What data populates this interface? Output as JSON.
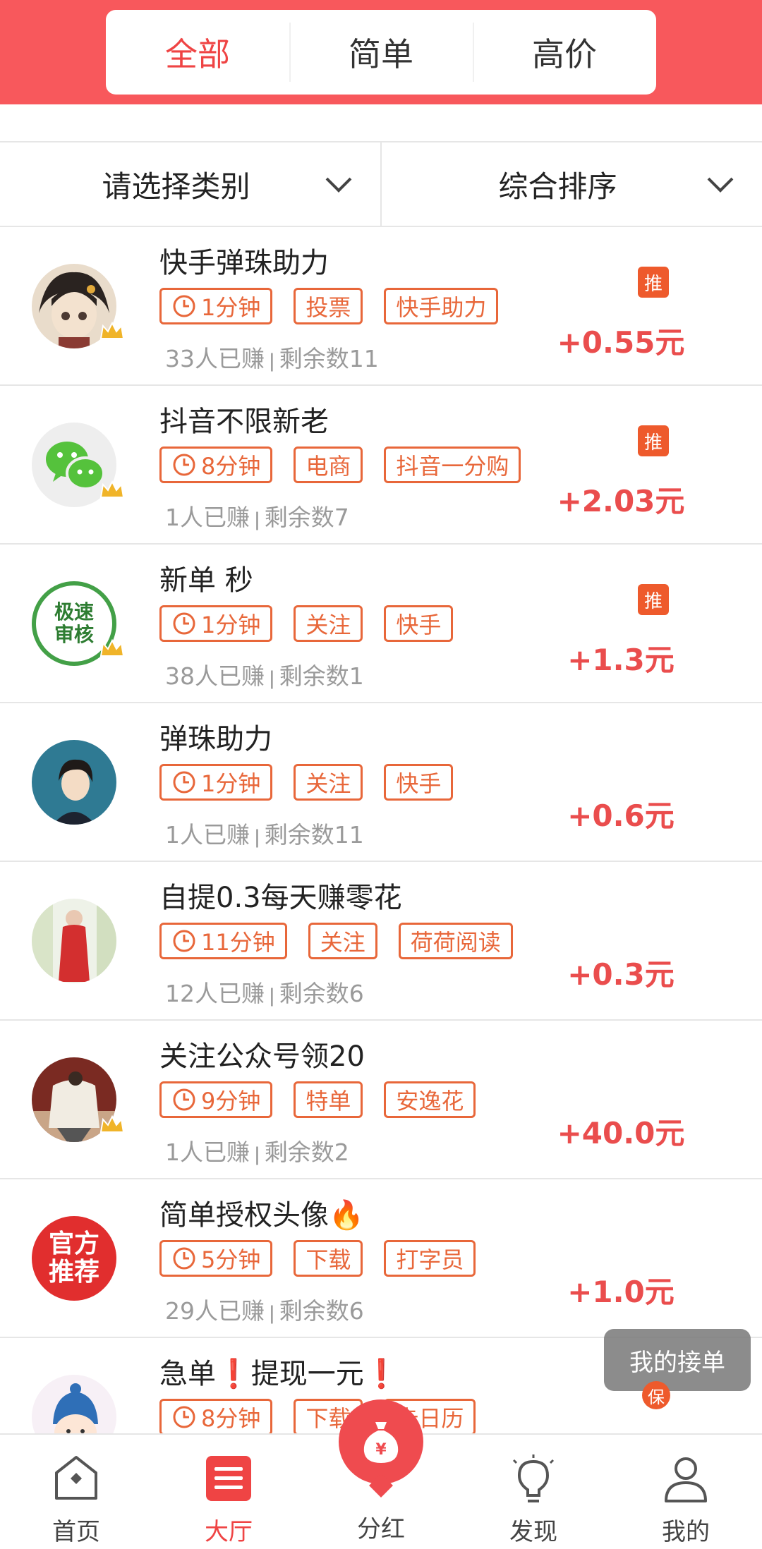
{
  "tabs": [
    {
      "label": "全部",
      "active": true
    },
    {
      "label": "简单",
      "active": false
    },
    {
      "label": "高价",
      "active": false
    }
  ],
  "filters": {
    "category": "请选择类别",
    "sort": "综合排序"
  },
  "tasks": [
    {
      "title": "快手弹珠助力",
      "duration": "1分钟",
      "tags": [
        "投票",
        "快手助力"
      ],
      "earned": "33人已赚",
      "remaining": "剩余数11",
      "reward": "+0.55元",
      "badge": "推",
      "avatar": "anime-boy-avatar"
    },
    {
      "title": "抖音不限新老",
      "duration": "8分钟",
      "tags": [
        "电商",
        "抖音一分购"
      ],
      "earned": "1人已赚",
      "remaining": "剩余数7",
      "reward": "+2.03元",
      "badge": "推",
      "avatar": "wechat-avatar"
    },
    {
      "title": "新单 秒",
      "duration": "1分钟",
      "tags": [
        "关注",
        "快手"
      ],
      "earned": "38人已赚",
      "remaining": "剩余数1",
      "reward": "+1.3元",
      "badge": "推",
      "avatar": "fast-review-avatar",
      "avatar_text": "极速审核"
    },
    {
      "title": "弹珠助力",
      "duration": "1分钟",
      "tags": [
        "关注",
        "快手"
      ],
      "earned": "1人已赚",
      "remaining": "剩余数11",
      "reward": "+0.6元",
      "badge": "",
      "avatar": "anime-avatar"
    },
    {
      "title": "自提0.3每天赚零花",
      "duration": "11分钟",
      "tags": [
        "关注",
        "荷荷阅读"
      ],
      "earned": "12人已赚",
      "remaining": "剩余数6",
      "reward": "+0.3元",
      "badge": "",
      "avatar": "photo-avatar"
    },
    {
      "title": "关注公众号领20",
      "duration": "9分钟",
      "tags": [
        "特单",
        "安逸花"
      ],
      "earned": "1人已赚",
      "remaining": "剩余数2",
      "reward": "+40.0元",
      "badge": "",
      "avatar": "photo-avatar-2"
    },
    {
      "title": "简单授权头像🔥",
      "duration": "5分钟",
      "tags": [
        "下载",
        "打字员"
      ],
      "earned": "29人已赚",
      "remaining": "剩余数6",
      "reward": "+1.0元",
      "badge": "",
      "avatar": "official-avatar",
      "avatar_text": "官方推荐"
    },
    {
      "title": "急单❗️提现一元❗️",
      "duration": "8分钟",
      "tags": [
        "下载",
        "卡日历"
      ],
      "earned": "",
      "remaining": "",
      "reward": "",
      "badge": "",
      "avatar": "cartoon-avatar"
    }
  ],
  "floating": {
    "label": "我的接单",
    "sub": "保"
  },
  "nav": [
    {
      "label": "首页",
      "icon": "home-icon",
      "active": false
    },
    {
      "label": "大厅",
      "icon": "hall-list-icon",
      "active": true
    },
    {
      "label": "分红",
      "icon": "money-bag-icon",
      "active": false
    },
    {
      "label": "发现",
      "icon": "lightbulb-icon",
      "active": false
    },
    {
      "label": "我的",
      "icon": "user-icon",
      "active": false
    }
  ],
  "colors": {
    "brand": "#f8585c",
    "tag": "#e8673a",
    "reward": "#ea4d4d"
  }
}
